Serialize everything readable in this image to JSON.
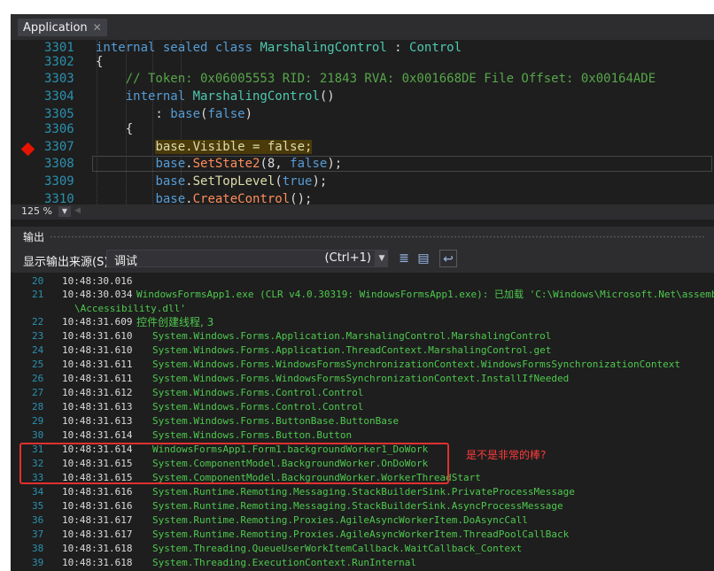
{
  "tab": {
    "title": "Application",
    "close": "✕"
  },
  "editor": {
    "lines": [
      {
        "num": "3301",
        "parts": [
          [
            "kw",
            "internal sealed class "
          ],
          [
            "ty",
            "MarshalingControl"
          ],
          [
            "id",
            " : "
          ],
          [
            "ty",
            "Control"
          ]
        ]
      },
      {
        "num": "3302",
        "parts": [
          [
            "id",
            "{"
          ]
        ]
      },
      {
        "num": "3303",
        "parts": [
          [
            "cm",
            "    // Token: 0x06005553 RID: 21843 RVA: 0x001668DE File Offset: 0x00164ADE"
          ]
        ]
      },
      {
        "num": "3304",
        "parts": [
          [
            "kw",
            "    internal "
          ],
          [
            "ty",
            "MarshalingControl"
          ],
          [
            "id",
            "()"
          ]
        ]
      },
      {
        "num": "3305",
        "parts": [
          [
            "id",
            "        : "
          ],
          [
            "kw",
            "base"
          ],
          [
            "id",
            "("
          ],
          [
            "kw",
            "false"
          ],
          [
            "id",
            ")"
          ]
        ]
      },
      {
        "num": "3306",
        "parts": [
          [
            "id",
            "    {"
          ]
        ]
      },
      {
        "num": "3307",
        "parts": [
          [
            "id",
            "        "
          ],
          [
            "hl",
            "base.Visible = false;"
          ]
        ]
      },
      {
        "num": "3308",
        "parts": [
          [
            "id",
            "        "
          ],
          [
            "kw",
            "base"
          ],
          [
            "id",
            "."
          ],
          [
            "mf",
            "SetState2"
          ],
          [
            "id",
            "(8, "
          ],
          [
            "kw",
            "false"
          ],
          [
            "id",
            ");"
          ]
        ]
      },
      {
        "num": "3309",
        "parts": [
          [
            "id",
            "        "
          ],
          [
            "kw",
            "base"
          ],
          [
            "id",
            "."
          ],
          [
            "fn",
            "SetTopLevel"
          ],
          [
            "id",
            "("
          ],
          [
            "kw",
            "true"
          ],
          [
            "id",
            ");"
          ]
        ]
      },
      {
        "num": "3310",
        "parts": [
          [
            "id",
            "        "
          ],
          [
            "kw",
            "base"
          ],
          [
            "id",
            "."
          ],
          [
            "mf",
            "CreateControl"
          ],
          [
            "id",
            "();"
          ]
        ]
      }
    ]
  },
  "zoom": {
    "level": "125 %"
  },
  "output": {
    "title": "输出",
    "source_label": "显示输出来源(S):",
    "source_value": "调试",
    "source_shortcut": "(Ctrl+1)",
    "lines": [
      {
        "n": "20",
        "t": "10:48:30.016",
        "msg": "",
        "kind": "plain"
      },
      {
        "n": "21",
        "t": "10:48:30.034",
        "msg": "WindowsFormsApp1.exe (CLR v4.0.30319: WindowsFormsApp1.exe): 已加载 'C:\\Windows\\Microsoft.Net\\assembly",
        "kind": "load"
      },
      {
        "n": "",
        "t": "",
        "msg": "\\Accessibility.dll'",
        "kind": "cont"
      },
      {
        "n": "22",
        "t": "10:48:31.609",
        "msg": "控件创建线程, 3",
        "kind": "thread"
      },
      {
        "n": "23",
        "t": "10:48:31.610",
        "msg": "System.Windows.Forms.Application.MarshalingControl.MarshalingControl",
        "kind": "frame"
      },
      {
        "n": "24",
        "t": "10:48:31.610",
        "msg": "System.Windows.Forms.Application.ThreadContext.MarshalingControl.get",
        "kind": "frame"
      },
      {
        "n": "25",
        "t": "10:48:31.611",
        "msg": "System.Windows.Forms.WindowsFormsSynchronizationContext.WindowsFormsSynchronizationContext",
        "kind": "frame"
      },
      {
        "n": "26",
        "t": "10:48:31.611",
        "msg": "System.Windows.Forms.WindowsFormsSynchronizationContext.InstallIfNeeded",
        "kind": "frame"
      },
      {
        "n": "27",
        "t": "10:48:31.612",
        "msg": "System.Windows.Forms.Control.Control",
        "kind": "frame"
      },
      {
        "n": "28",
        "t": "10:48:31.613",
        "msg": "System.Windows.Forms.Control.Control",
        "kind": "frame"
      },
      {
        "n": "29",
        "t": "10:48:31.613",
        "msg": "System.Windows.Forms.ButtonBase.ButtonBase",
        "kind": "frame"
      },
      {
        "n": "30",
        "t": "10:48:31.614",
        "msg": "System.Windows.Forms.Button.Button",
        "kind": "frame"
      },
      {
        "n": "31",
        "t": "10:48:31.614",
        "msg": "WindowsFormsApp1.Form1.backgroundWorker1_DoWork",
        "kind": "frame"
      },
      {
        "n": "32",
        "t": "10:48:31.615",
        "msg": "System.ComponentModel.BackgroundWorker.OnDoWork",
        "kind": "frame"
      },
      {
        "n": "33",
        "t": "10:48:31.615",
        "msg": "System.ComponentModel.BackgroundWorker.WorkerThreadStart",
        "kind": "frame"
      },
      {
        "n": "34",
        "t": "10:48:31.616",
        "msg": "System.Runtime.Remoting.Messaging.StackBuilderSink.PrivateProcessMessage",
        "kind": "frame"
      },
      {
        "n": "35",
        "t": "10:48:31.616",
        "msg": "System.Runtime.Remoting.Messaging.StackBuilderSink.AsyncProcessMessage",
        "kind": "frame"
      },
      {
        "n": "36",
        "t": "10:48:31.617",
        "msg": "System.Runtime.Remoting.Proxies.AgileAsyncWorkerItem.DoAsyncCall",
        "kind": "frame"
      },
      {
        "n": "37",
        "t": "10:48:31.617",
        "msg": "System.Runtime.Remoting.Proxies.AgileAsyncWorkerItem.ThreadPoolCallBack",
        "kind": "frame"
      },
      {
        "n": "38",
        "t": "10:48:31.618",
        "msg": "System.Threading.QueueUserWorkItemCallback.WaitCallback_Context",
        "kind": "frame"
      },
      {
        "n": "39",
        "t": "10:48:31.618",
        "msg": "System.Threading.ExecutionContext.RunInternal",
        "kind": "frame"
      }
    ],
    "annotation": "是不是非常的棒?"
  },
  "colors": {
    "keyword": "#569cd6",
    "type": "#4ec9b0",
    "comment": "#57a64a",
    "output_green": "#4ec94e",
    "highlight": "#e0312f"
  },
  "icons": {
    "breakpoint": "breakpoint-icon",
    "clear": "clear-all-icon",
    "save": "save-icon",
    "wrap": "word-wrap-icon"
  }
}
